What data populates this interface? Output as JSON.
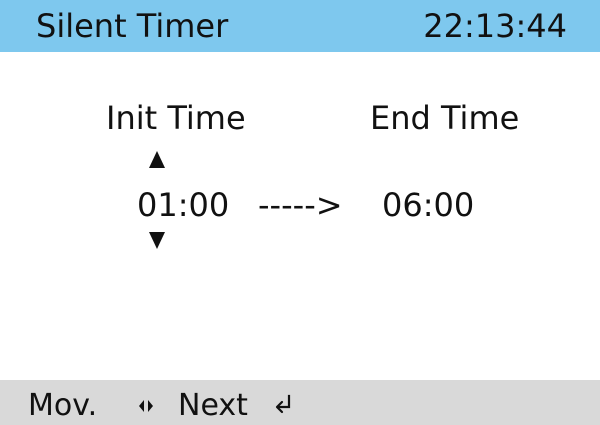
{
  "header": {
    "title": "Silent Timer",
    "clock": "22:13:44",
    "background_color": "#7ec8ee"
  },
  "labels": {
    "init_time": "Init  Time",
    "end_time": "End  Time"
  },
  "timer": {
    "init_value": "01:00",
    "range_arrow": "----->",
    "end_value": "06:00",
    "up_icon": "up-triangle-icon",
    "down_icon": "down-triangle-icon"
  },
  "footer": {
    "mov_label": "Mov.",
    "move_icon": "left-right-arrows-icon",
    "next_label": "Next",
    "enter_icon": "enter-return-icon",
    "background_color": "#d9d9d9"
  }
}
